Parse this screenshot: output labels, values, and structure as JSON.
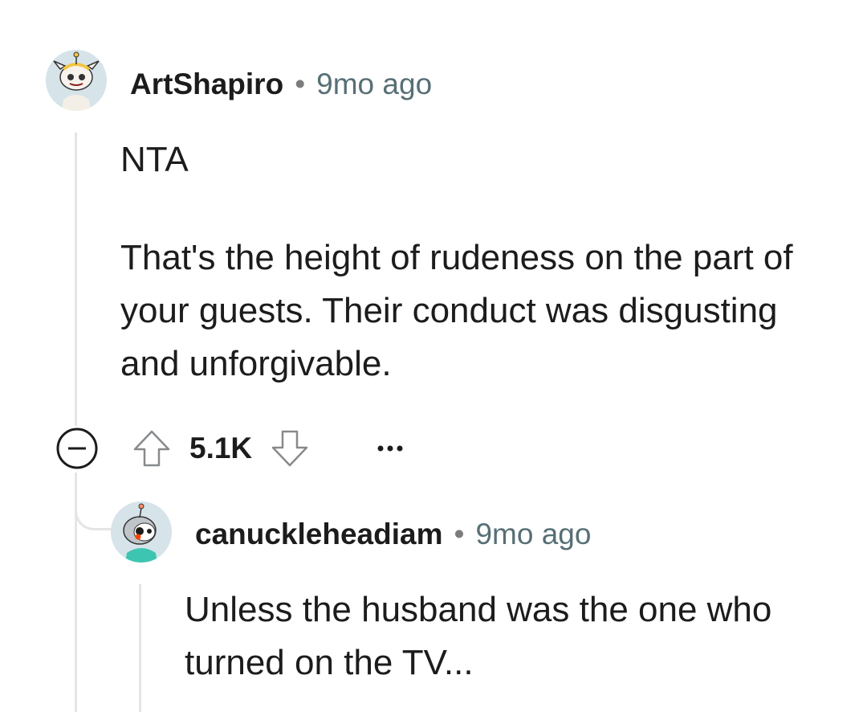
{
  "comments": [
    {
      "username": "ArtShapiro",
      "separator": "•",
      "time": "9mo ago",
      "verdict": "NTA",
      "body": "That's the height of rudeness on the part of your guests. Their conduct was disgusting and unforgivable.",
      "score": "5.1K",
      "avatar": "snoo-avatar-cat-helmet"
    },
    {
      "username": "canuckleheadiam",
      "separator": "•",
      "time": "9mo ago",
      "body": "Unless the husband was the one who turned on the TV...",
      "avatar": "snoo-avatar-teal-shirt"
    }
  ],
  "icons": {
    "collapse": "collapse-minus-icon",
    "upvote": "upvote-arrow-icon",
    "downvote": "downvote-arrow-icon",
    "more": "more-options-icon"
  },
  "colors": {
    "text": "#1c1c1c",
    "meta": "#576f76",
    "thread_line": "#e5e5e5",
    "avatar_bg": "#d6e4ea"
  }
}
